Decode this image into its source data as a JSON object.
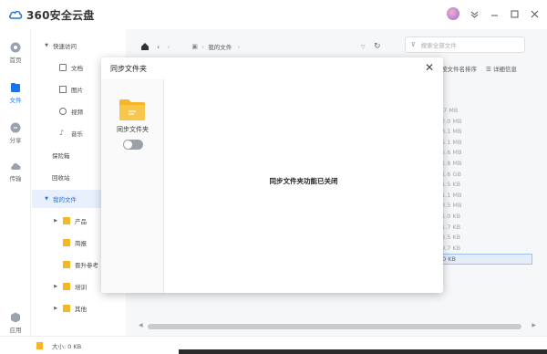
{
  "app": {
    "title": "360安全云盘"
  },
  "rail": {
    "items": [
      {
        "label": "首页",
        "icon": "home-icon"
      },
      {
        "label": "文件",
        "icon": "file-icon"
      },
      {
        "label": "分享",
        "icon": "share-icon"
      },
      {
        "label": "传输",
        "icon": "transfer-icon"
      },
      {
        "label": "应用",
        "icon": "apps-icon"
      }
    ]
  },
  "tree": {
    "quick_access": "快速访问",
    "quick_items": [
      "文档",
      "图片",
      "视频",
      "音乐"
    ],
    "safe_box": "保险箱",
    "recycle": "回收站",
    "my_files": "我的文件",
    "my_file_items": [
      "产品",
      "简报",
      "晋升参考",
      "培训",
      "其他"
    ]
  },
  "toolbar": {
    "breadcrumb": "我的文件",
    "search_placeholder": "搜索全部文件",
    "sort_label": "按文件名排序",
    "detail_label": "详细信息"
  },
  "list": {
    "sizes": [
      ".7 MB",
      "2.0 MB",
      "3.1 MB",
      "5.1 MB",
      "5.6 MB",
      "1.8 MB",
      "1.6 GB",
      "1.5 KB",
      "1.1 MB",
      "3.5 MB",
      "1.0 KB",
      "1.7 KB",
      "3.5 KB",
      "9.7 KB",
      "0 KB"
    ]
  },
  "status": {
    "size_text": "大小: 0 KB"
  },
  "modal": {
    "title": "同步文件夹",
    "side_label": "同步文件夹",
    "message": "同步文件夹功能已关闭",
    "toggle_on": false
  },
  "colors": {
    "accent": "#1a73e8",
    "folder": "#f5b62a"
  }
}
